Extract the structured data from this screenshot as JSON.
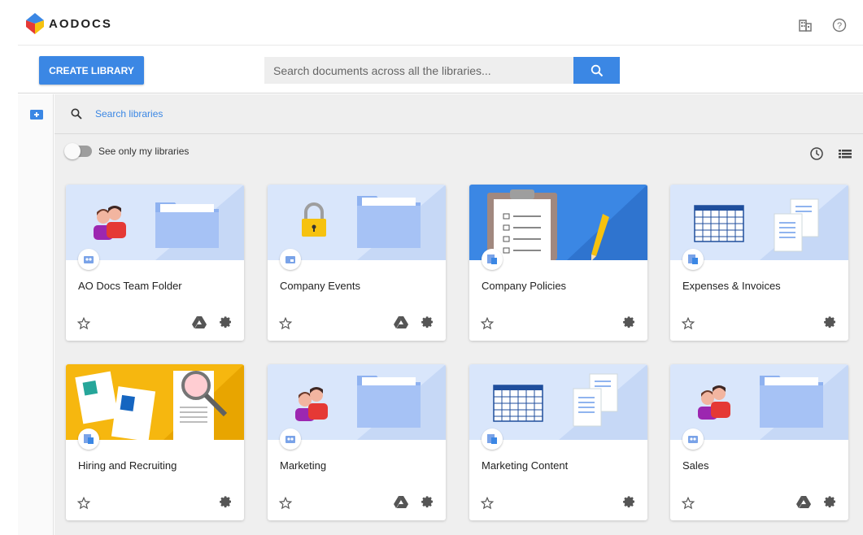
{
  "app": {
    "logo_text": "AODOCS",
    "accent": "#3b87e4",
    "gold": "#f6c20f"
  },
  "header": {
    "icons": [
      "domain-icon",
      "help-icon"
    ]
  },
  "toolbar": {
    "create_label": "CREATE LIBRARY",
    "search_placeholder": "Search documents across all the libraries..."
  },
  "libraries_panel": {
    "search_label": "Search libraries",
    "toggle_label": "See only my libraries",
    "view_icons": [
      "history-icon",
      "list-view-icon"
    ]
  },
  "cards": [
    {
      "title": "AO Docs Team Folder",
      "art": "people-folder",
      "drive": true
    },
    {
      "title": "Company Events",
      "art": "lock-folder",
      "drive": true
    },
    {
      "title": "Company Policies",
      "art": "clipboard",
      "drive": false
    },
    {
      "title": "Expenses & Invoices",
      "art": "spreadsheet-docs",
      "drive": false
    },
    {
      "title": "Hiring and Recruiting",
      "art": "resumes",
      "drive": false
    },
    {
      "title": "Marketing",
      "art": "people-folder",
      "drive": true
    },
    {
      "title": "Marketing Content",
      "art": "spreadsheet-docs",
      "drive": false
    },
    {
      "title": "Sales",
      "art": "people-folder",
      "drive": true
    }
  ]
}
